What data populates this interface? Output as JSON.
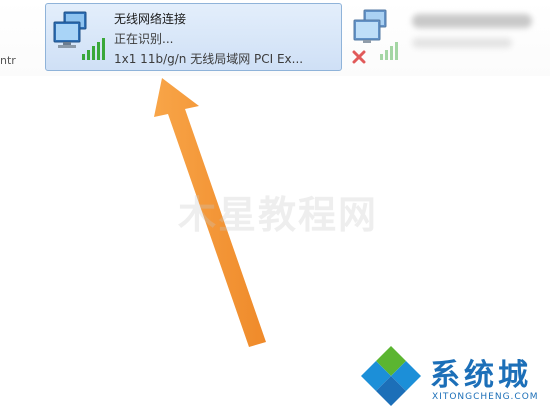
{
  "adapters": {
    "left": {
      "partial_label": "ntr"
    },
    "selected": {
      "name": "无线网络连接",
      "status": "正在识别...",
      "device": "1x1 11b/g/n 无线局域网 PCI Ex..."
    },
    "right": {
      "name": "",
      "status_icon": "red-x-icon"
    }
  },
  "watermarks": {
    "center": "木星教程网",
    "brand_cn": "系统城",
    "brand_en": "XITONGCHENG.COM"
  },
  "colors": {
    "selection_bg": "#cfe0f6",
    "selection_border": "#8fb3d9",
    "arrow": "#f59a3a",
    "signal": "#3aa83a",
    "error_x": "#d92525",
    "brand_blue": "#1c6fb8",
    "brand_green": "#5bb531"
  }
}
